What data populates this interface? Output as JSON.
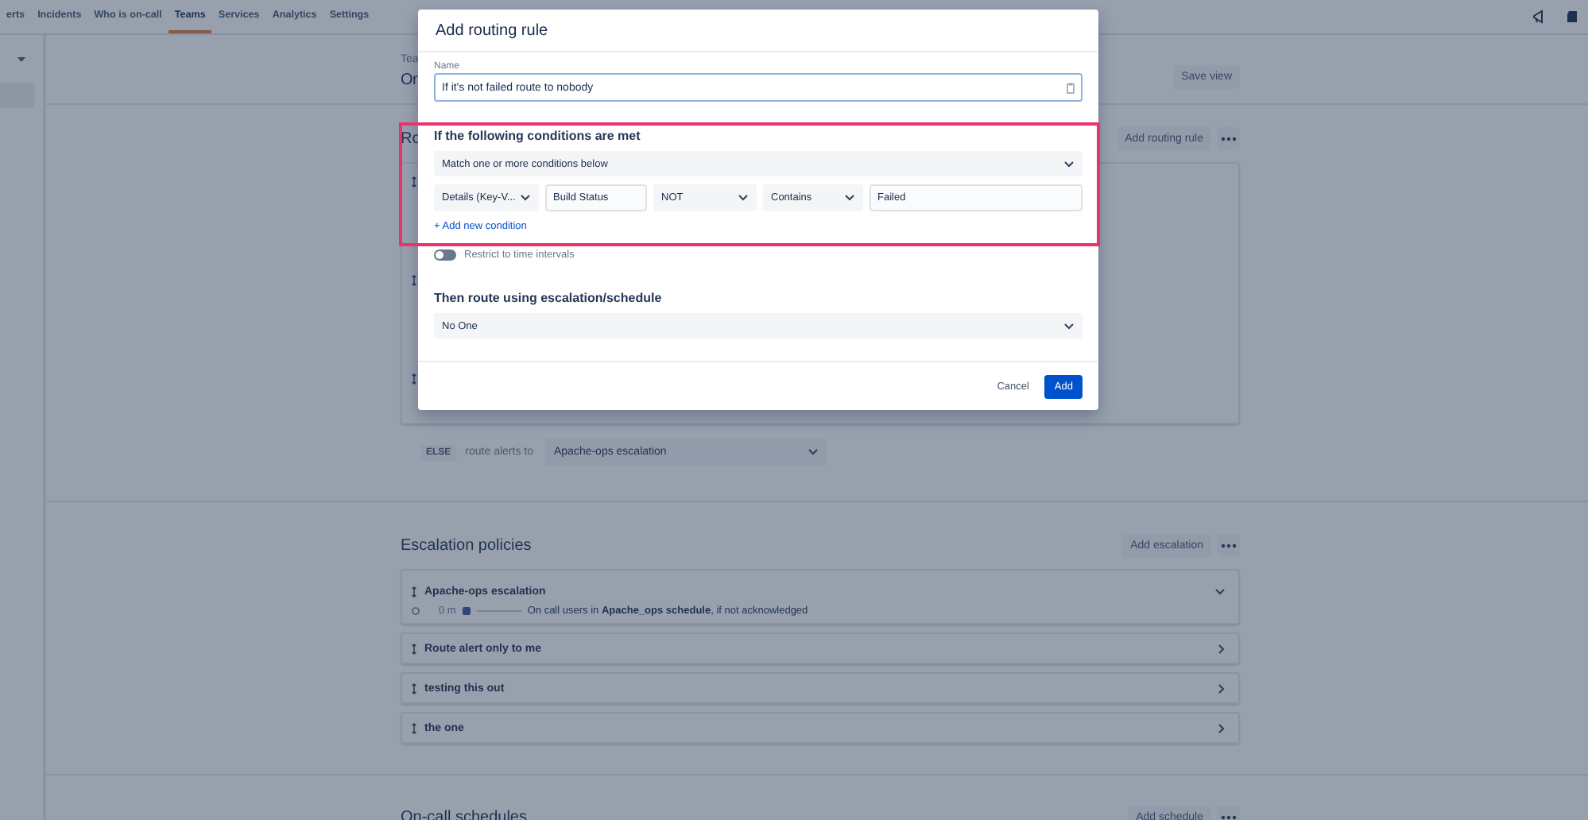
{
  "nav": {
    "items": [
      {
        "label": "erts",
        "selected": false
      },
      {
        "label": "Incidents",
        "selected": false
      },
      {
        "label": "Who is on-call",
        "selected": false
      },
      {
        "label": "Teams",
        "selected": true
      },
      {
        "label": "Services",
        "selected": false
      },
      {
        "label": "Analytics",
        "selected": false
      },
      {
        "label": "Settings",
        "selected": false
      }
    ]
  },
  "page": {
    "breadcrumb": "Tea",
    "title": "On",
    "save_button": "Save view",
    "routing": {
      "heading": "Ro",
      "add_button": "Add routing rule",
      "else_badge": "ELSE",
      "else_text": "route alerts to",
      "else_select": "Apache-ops escalation"
    },
    "escalation": {
      "heading": "Escalation policies",
      "add_button": "Add escalation",
      "policies": [
        {
          "name": "Apache-ops escalation",
          "expanded": true,
          "step": {
            "delay": "0 m",
            "text": "On call users in **Apache_ops schedule**, if not acknowledged"
          }
        },
        {
          "name": "Route alert only to me",
          "expanded": false
        },
        {
          "name": "testing this out",
          "expanded": false
        },
        {
          "name": "the one",
          "expanded": false
        }
      ]
    },
    "schedules": {
      "heading": "On-call schedules",
      "add_button": "Add schedule"
    }
  },
  "modal": {
    "title": "Add routing rule",
    "name_label": "Name",
    "name_value": "If it's not failed route to nobody",
    "conditions_heading": "If the following conditions are met",
    "match_select": "Match one or more conditions below",
    "condition": [
      {
        "kind": "select",
        "value": "Details (Key-V..."
      },
      {
        "kind": "input",
        "value": "Build Status"
      },
      {
        "kind": "select",
        "value": "NOT"
      },
      {
        "kind": "select",
        "value": "Contains"
      },
      {
        "kind": "input",
        "value": "Failed"
      }
    ],
    "add_condition": "+ Add new condition",
    "time_toggle": {
      "label": "Restrict to time intervals",
      "on": false
    },
    "route_heading": "Then route using escalation/schedule",
    "route_select": "No One",
    "cancel": "Cancel",
    "submit": "Add"
  }
}
